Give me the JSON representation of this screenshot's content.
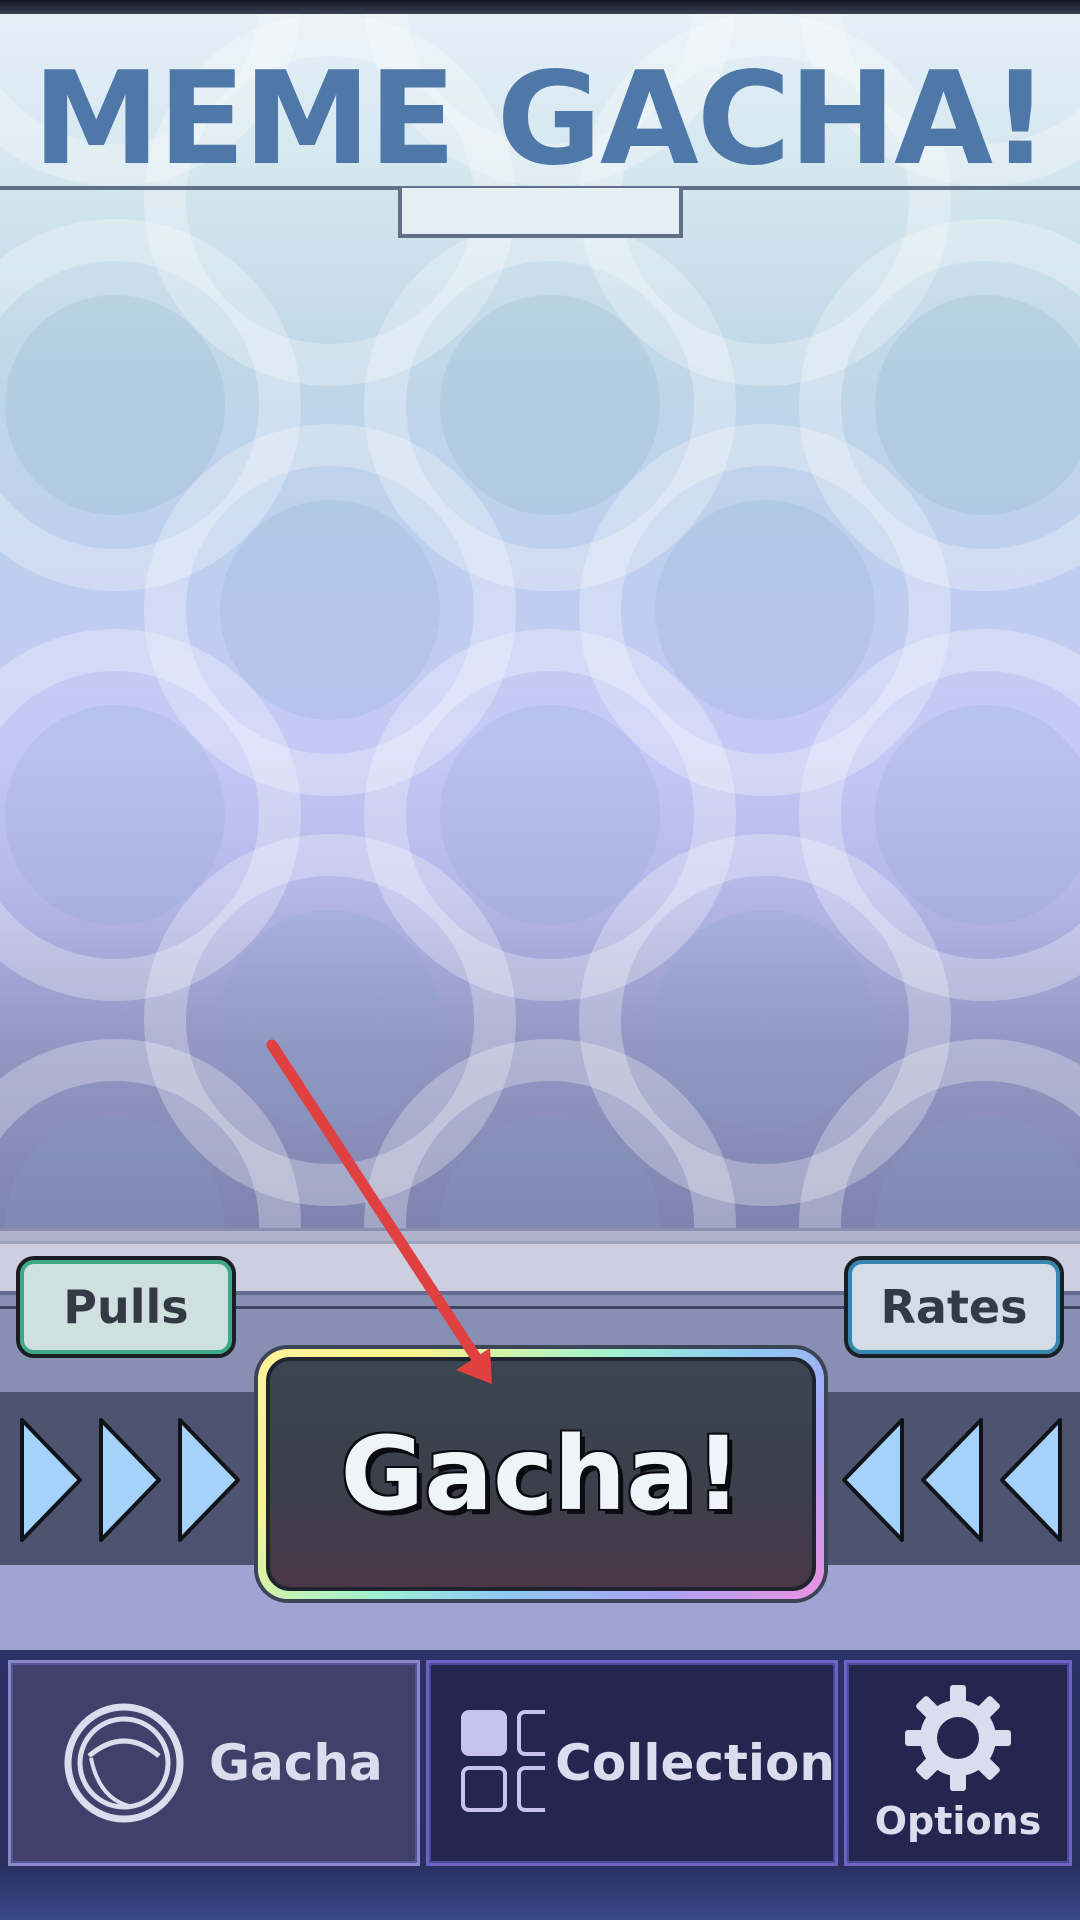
{
  "game": {
    "title": "MEME GACHA!"
  },
  "buttons": {
    "pulls_label": "Pulls",
    "rates_label": "Rates",
    "gacha_label": "Gacha!"
  },
  "nav": {
    "tabs": [
      {
        "label": "Gacha",
        "icon": "orb-icon",
        "active": true
      },
      {
        "label": "Collection",
        "icon": "grid-icon",
        "active": false
      },
      {
        "label": "Options",
        "icon": "gear-icon",
        "active": false
      }
    ]
  },
  "colors": {
    "title": "#4e78a8",
    "pulls_border": "#3daa86",
    "rates_border": "#3486b0",
    "arrow_fill": "#a4d2fa",
    "annotation_arrow": "#e04040"
  },
  "annotation": {
    "type": "arrow",
    "points_to": "gacha-button"
  }
}
